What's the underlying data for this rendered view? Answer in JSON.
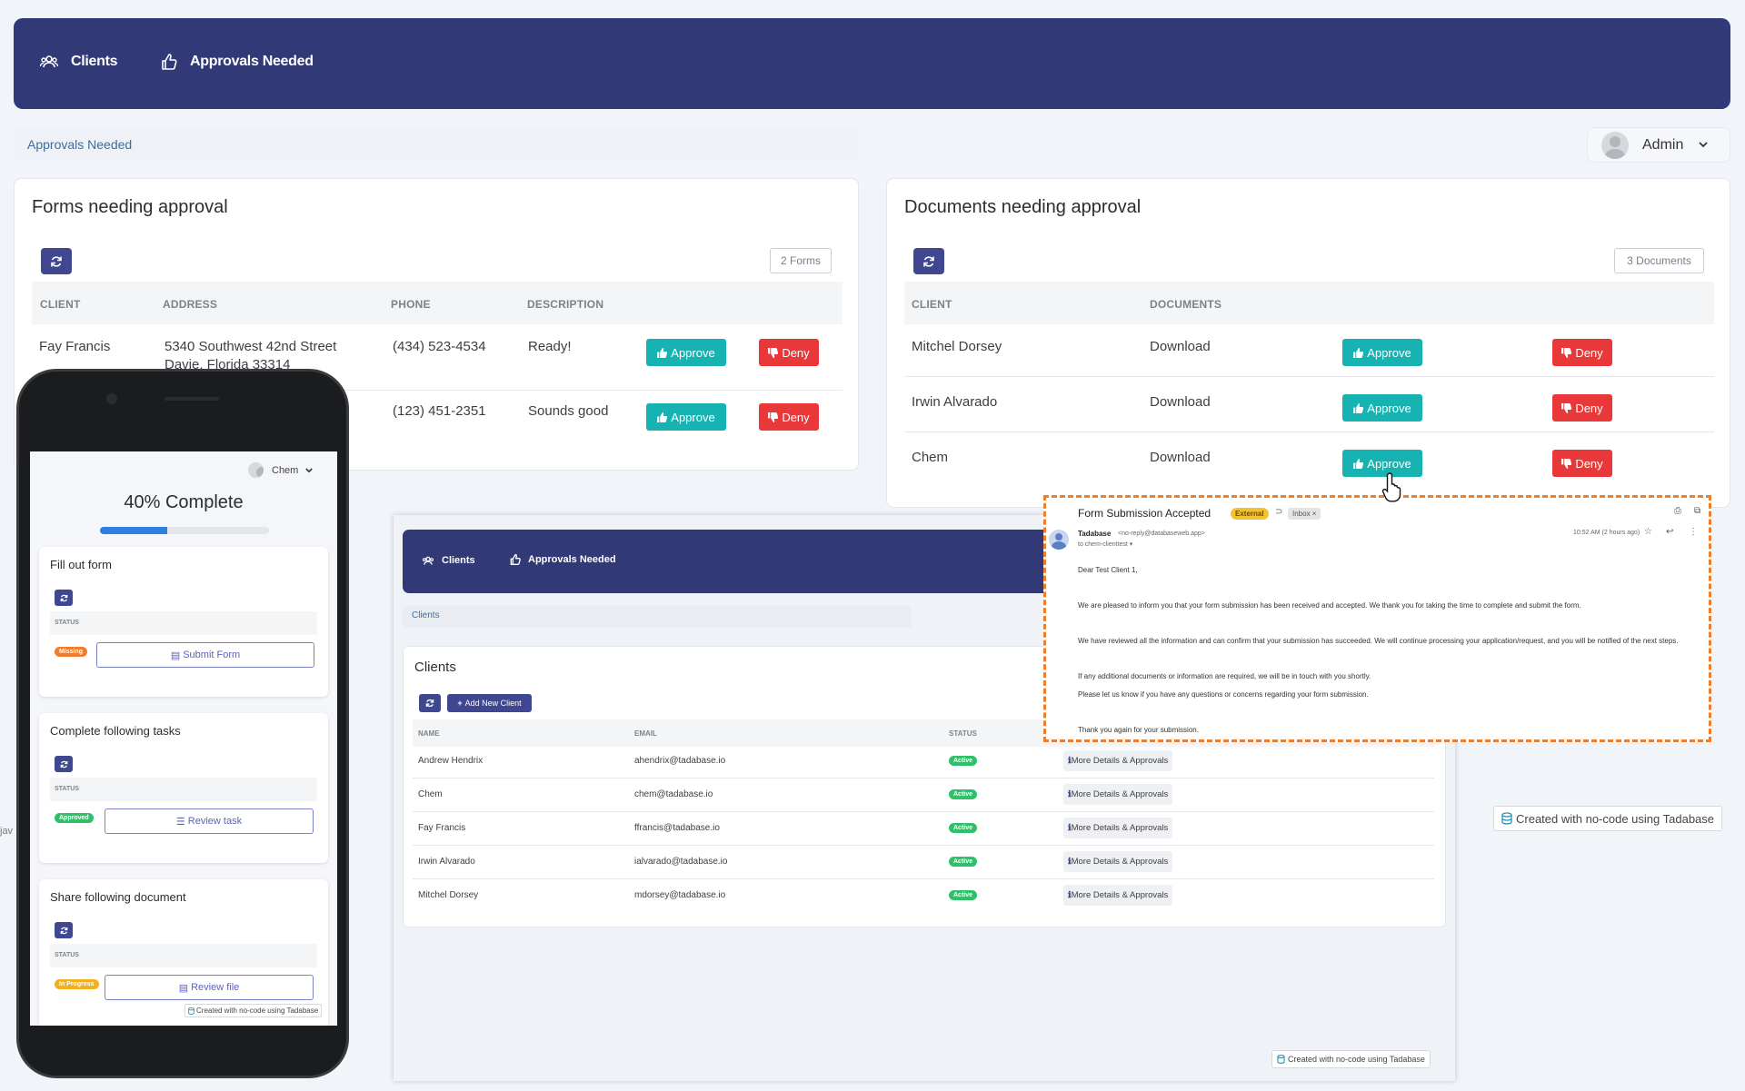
{
  "nav": {
    "clients": "Clients",
    "approvals": "Approvals Needed"
  },
  "breadcrumb": "Approvals Needed",
  "user": {
    "name": "Admin"
  },
  "forms": {
    "title": "Forms needing approval",
    "count": "2 Forms",
    "headers": [
      "CLIENT",
      "ADDRESS",
      "PHONE",
      "DESCRIPTION"
    ],
    "rows": [
      {
        "client": "Fay Francis",
        "address_line1": "5340 Southwest 42nd Street",
        "address_line2": "Davie, Florida 33314",
        "phone": "(434) 523-4534",
        "description": "Ready!"
      },
      {
        "client": "",
        "address_line1": "",
        "address_line2": "",
        "phone": "(123) 451-2351",
        "description": "Sounds good"
      }
    ],
    "approve": "Approve",
    "deny": "Deny"
  },
  "documents": {
    "title": "Documents needing approval",
    "count": "3 Documents",
    "headers": [
      "CLIENT",
      "DOCUMENTS"
    ],
    "rows": [
      {
        "client": "Mitchel Dorsey",
        "doc": "Download"
      },
      {
        "client": "Irwin Alvarado",
        "doc": "Download"
      },
      {
        "client": "Chem",
        "doc": "Download"
      }
    ],
    "approve": "Approve",
    "deny": "Deny"
  },
  "tadabase_badge": "Created with no-code using Tadabase",
  "side_text": "jav",
  "phone": {
    "user": "Chem",
    "progress_title": "40% Complete",
    "progress": 0.4,
    "cards": [
      {
        "title": "Fill out form",
        "status_label": "STATUS",
        "badge": "Missing",
        "badge_color": "#f07d2c",
        "action": "Submit Form"
      },
      {
        "title": "Complete following tasks",
        "status_label": "STATUS",
        "badge": "Approved",
        "badge_color": "#2fc16a",
        "action": "Review task"
      },
      {
        "title": "Share following document",
        "status_label": "STATUS",
        "badge": "In Progress",
        "badge_color": "#f2b01e",
        "action": "Review file"
      }
    ],
    "badge": "Created with no-code using Tadabase"
  },
  "inner": {
    "nav": {
      "clients": "Clients",
      "approvals": "Approvals Needed"
    },
    "breadcrumb": "Clients",
    "title": "Clients",
    "add_button": "Add New Client",
    "headers": [
      "NAME",
      "EMAIL",
      "STATUS"
    ],
    "rows": [
      {
        "name": "Andrew Hendrix",
        "email": "ahendrix@tadabase.io",
        "status": "Active",
        "action": "More Details & Approvals"
      },
      {
        "name": "Chem",
        "email": "chem@tadabase.io",
        "status": "Active",
        "action": "More Details & Approvals"
      },
      {
        "name": "Fay Francis",
        "email": "ffrancis@tadabase.io",
        "status": "Active",
        "action": "More Details & Approvals"
      },
      {
        "name": "Irwin Alvarado",
        "email": "ialvarado@tadabase.io",
        "status": "Active",
        "action": "More Details & Approvals"
      },
      {
        "name": "Mitchel Dorsey",
        "email": "mdorsey@tadabase.io",
        "status": "Active",
        "action": "More Details & Approvals"
      }
    ],
    "badge": "Created with no-code using Tadabase"
  },
  "email": {
    "subject": "Form Submission Accepted",
    "tag_external": "External",
    "tag_inbox": "Inbox ×",
    "sender": "Tadabase",
    "sender_addr": "<no-reply@databaseweb.app>",
    "to": "to chem-clienttest ▾",
    "time": "10:52 AM (2 hours ago)",
    "lines": [
      "Dear Test Client 1,",
      "We are pleased to inform you that your form submission has been received and accepted. We thank you for taking the time to complete and submit the form.",
      "We have reviewed all the information and can confirm that your submission has succeeded. We will continue processing your application/request, and you will be notified of the next steps.",
      "If any additional documents or information are required, we will be in touch with you shortly.",
      "Please let us know if you have any questions or concerns regarding your form submission.",
      "Thank you again for your submission."
    ]
  }
}
